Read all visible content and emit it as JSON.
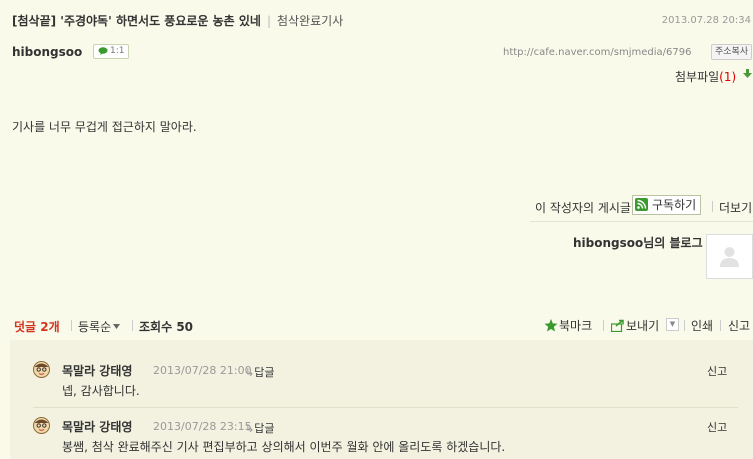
{
  "article": {
    "title": "[첨삭끝] '주경야독' 하면서도 풍요로운 농촌 있네",
    "category": "첨삭완료기사",
    "date": "2013.07.28 20:34",
    "author": "hibongsoo",
    "chat_badge": "1:1",
    "url": "http://cafe.naver.com/smjmedia/6796",
    "copy_url_label": "주소복사",
    "attachment_label": "첨부파일",
    "attachment_count_text": "(1)",
    "body": "기사를 너무 무겁게 접근하지 말아라."
  },
  "subscribe": {
    "label": "이 작성자의 게시글",
    "button": "구독하기",
    "more": "더보기"
  },
  "blog": {
    "label": "hibongsoo님의 블로그"
  },
  "comment_bar": {
    "count": "덧글 2개",
    "sort": "등록순",
    "views_label": "조회수",
    "views": "50",
    "bookmark": "북마크",
    "send": "보내기",
    "print": "인쇄",
    "report": "신고"
  },
  "comments": [
    {
      "name": "목말라 강태영",
      "date": "2013/07/28 21:00",
      "reply": "답글",
      "report": "신고",
      "text": "넵, 감사합니다."
    },
    {
      "name": "목말라 강태영",
      "date": "2013/07/28 23:15",
      "reply": "답글",
      "report": "신고",
      "text": "봉쌤, 첨삭 완료해주신 기사 편집부하고 상의해서 이번주 월화 안에 올리도록 하겠습니다."
    }
  ],
  "colors": {
    "background": "#fafaeb",
    "comment_background": "#f3f2e1",
    "accent_red": "#d4331c",
    "rss_green": "#3a9a2e"
  }
}
